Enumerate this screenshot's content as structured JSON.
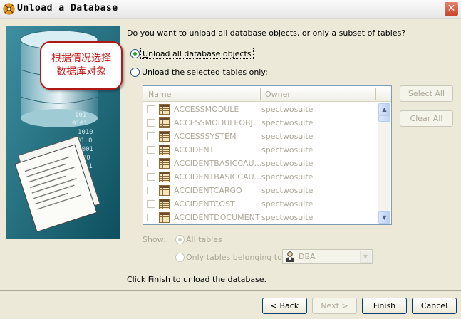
{
  "window": {
    "title": "Unload a Database",
    "app_icon": "sybase-icon",
    "close_glyph": "✕"
  },
  "callout": {
    "line1": "根据情况选择",
    "line2": "数据库对象"
  },
  "question": "Do you want to unload all database objects, or only a subset of tables?",
  "options": {
    "unload_all": {
      "label": "Unload all database objects",
      "checked": true
    },
    "unload_selected": {
      "label": "Unload the selected tables only:",
      "checked": false
    }
  },
  "table_list": {
    "columns": [
      "Name",
      "Owner"
    ],
    "rows": [
      {
        "name": "ACCESSMODULE",
        "owner": "spectwosuite"
      },
      {
        "name": "ACCESSMODULEOBJE...",
        "owner": "spectwosuite"
      },
      {
        "name": "ACCESSSYSTEM",
        "owner": "spectwosuite"
      },
      {
        "name": "ACCIDENT",
        "owner": "spectwosuite"
      },
      {
        "name": "ACCIDENTBASICCAUS...",
        "owner": "spectwosuite"
      },
      {
        "name": "ACCIDENTBASICCAUS...",
        "owner": "spectwosuite"
      },
      {
        "name": "ACCIDENTCARGO",
        "owner": "spectwosuite"
      },
      {
        "name": "ACCIDENTCOST",
        "owner": "spectwosuite"
      },
      {
        "name": "ACCIDENTDOCUMENT",
        "owner": "spectwosuite"
      }
    ]
  },
  "side_buttons": {
    "select_all": "Select All",
    "clear_all": "Clear All"
  },
  "show": {
    "label": "Show:",
    "all_tables": "All tables",
    "only_tables": "Only tables belonging to:",
    "owner_value": "DBA"
  },
  "footer_text": "Click Finish to unload the database.",
  "buttons": {
    "back": "< Back",
    "next": "Next >",
    "finish": "Finish",
    "cancel": "Cancel"
  },
  "colors": {
    "callout_border": "#b01818",
    "callout_text": "#c81818",
    "radio_dot": "#21a121",
    "disabled_text": "#aca899"
  }
}
